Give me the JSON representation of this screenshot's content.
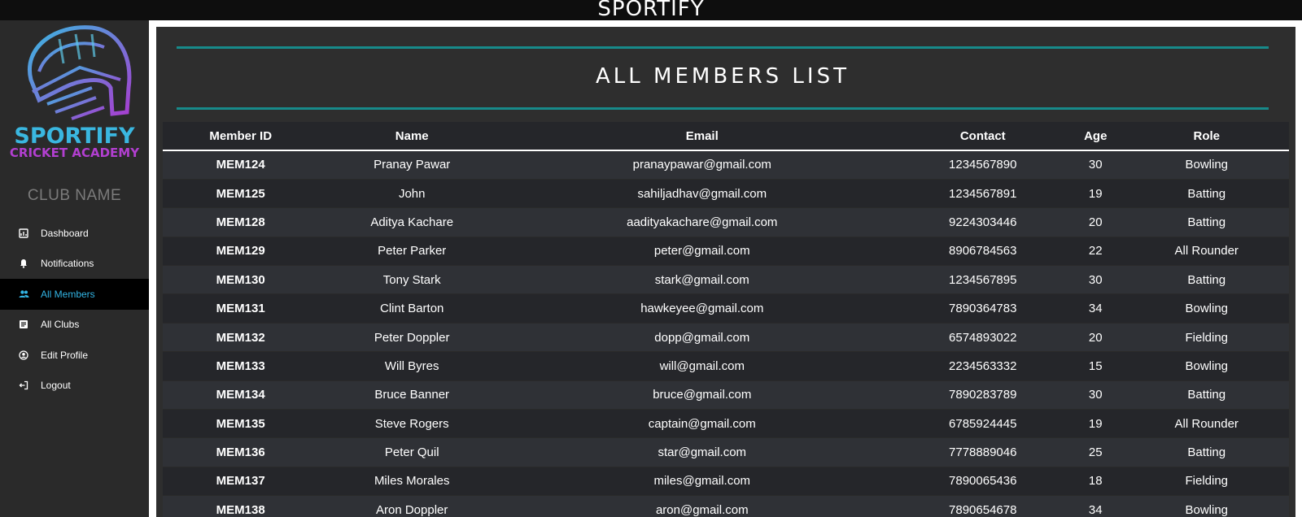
{
  "app": {
    "brand": "SPORTIFY"
  },
  "sidebar": {
    "logo": {
      "line1": "SPORTIFY",
      "line2": "CRICKET ACADEMY"
    },
    "club_name": "CLUB NAME",
    "items": [
      {
        "label": "Dashboard",
        "icon": "dashboard-icon"
      },
      {
        "label": "Notifications",
        "icon": "bell-icon"
      },
      {
        "label": "All Members",
        "icon": "users-icon",
        "active": true
      },
      {
        "label": "All Clubs",
        "icon": "clubs-icon"
      },
      {
        "label": "Edit Profile",
        "icon": "profile-icon"
      },
      {
        "label": "Logout",
        "icon": "logout-icon"
      }
    ]
  },
  "main": {
    "title": "ALL MEMBERS LIST",
    "columns": [
      "Member ID",
      "Name",
      "Email",
      "Contact",
      "Age",
      "Role"
    ],
    "rows": [
      [
        "MEM124",
        "Pranay Pawar",
        "pranaypawar@gmail.com",
        "1234567890",
        "30",
        "Bowling"
      ],
      [
        "MEM125",
        "John",
        "sahiljadhav@gmail.com",
        "1234567891",
        "19",
        "Batting"
      ],
      [
        "MEM128",
        "Aditya Kachare",
        "aadityakachare@gmail.com",
        "9224303446",
        "20",
        "Batting"
      ],
      [
        "MEM129",
        "Peter Parker",
        "peter@gmail.com",
        "8906784563",
        "22",
        "All Rounder"
      ],
      [
        "MEM130",
        "Tony Stark",
        "stark@gmail.com",
        "1234567895",
        "30",
        "Batting"
      ],
      [
        "MEM131",
        "Clint Barton",
        "hawkeyee@gmail.com",
        "7890364783",
        "34",
        "Bowling"
      ],
      [
        "MEM132",
        "Peter Doppler",
        "dopp@gmail.com",
        "6574893022",
        "20",
        "Fielding"
      ],
      [
        "MEM133",
        "Will Byres",
        "will@gmail.com",
        "2234563332",
        "15",
        "Bowling"
      ],
      [
        "MEM134",
        "Bruce Banner",
        "bruce@gmail.com",
        "7890283789",
        "30",
        "Batting"
      ],
      [
        "MEM135",
        "Steve Rogers",
        "captain@gmail.com",
        "6785924445",
        "19",
        "All Rounder"
      ],
      [
        "MEM136",
        "Peter Quil",
        "star@gmail.com",
        "7778889046",
        "25",
        "Batting"
      ],
      [
        "MEM137",
        "Miles Morales",
        "miles@gmail.com",
        "7890065436",
        "18",
        "Fielding"
      ],
      [
        "MEM138",
        "Aron Doppler",
        "aron@gmail.com",
        "7890654678",
        "34",
        "Bowling"
      ]
    ]
  },
  "colors": {
    "accent_teal": "#178a8a",
    "active_nav": "#33b5e5",
    "logo_blue": "#3ab7e0",
    "logo_purple": "#b23fd0"
  }
}
